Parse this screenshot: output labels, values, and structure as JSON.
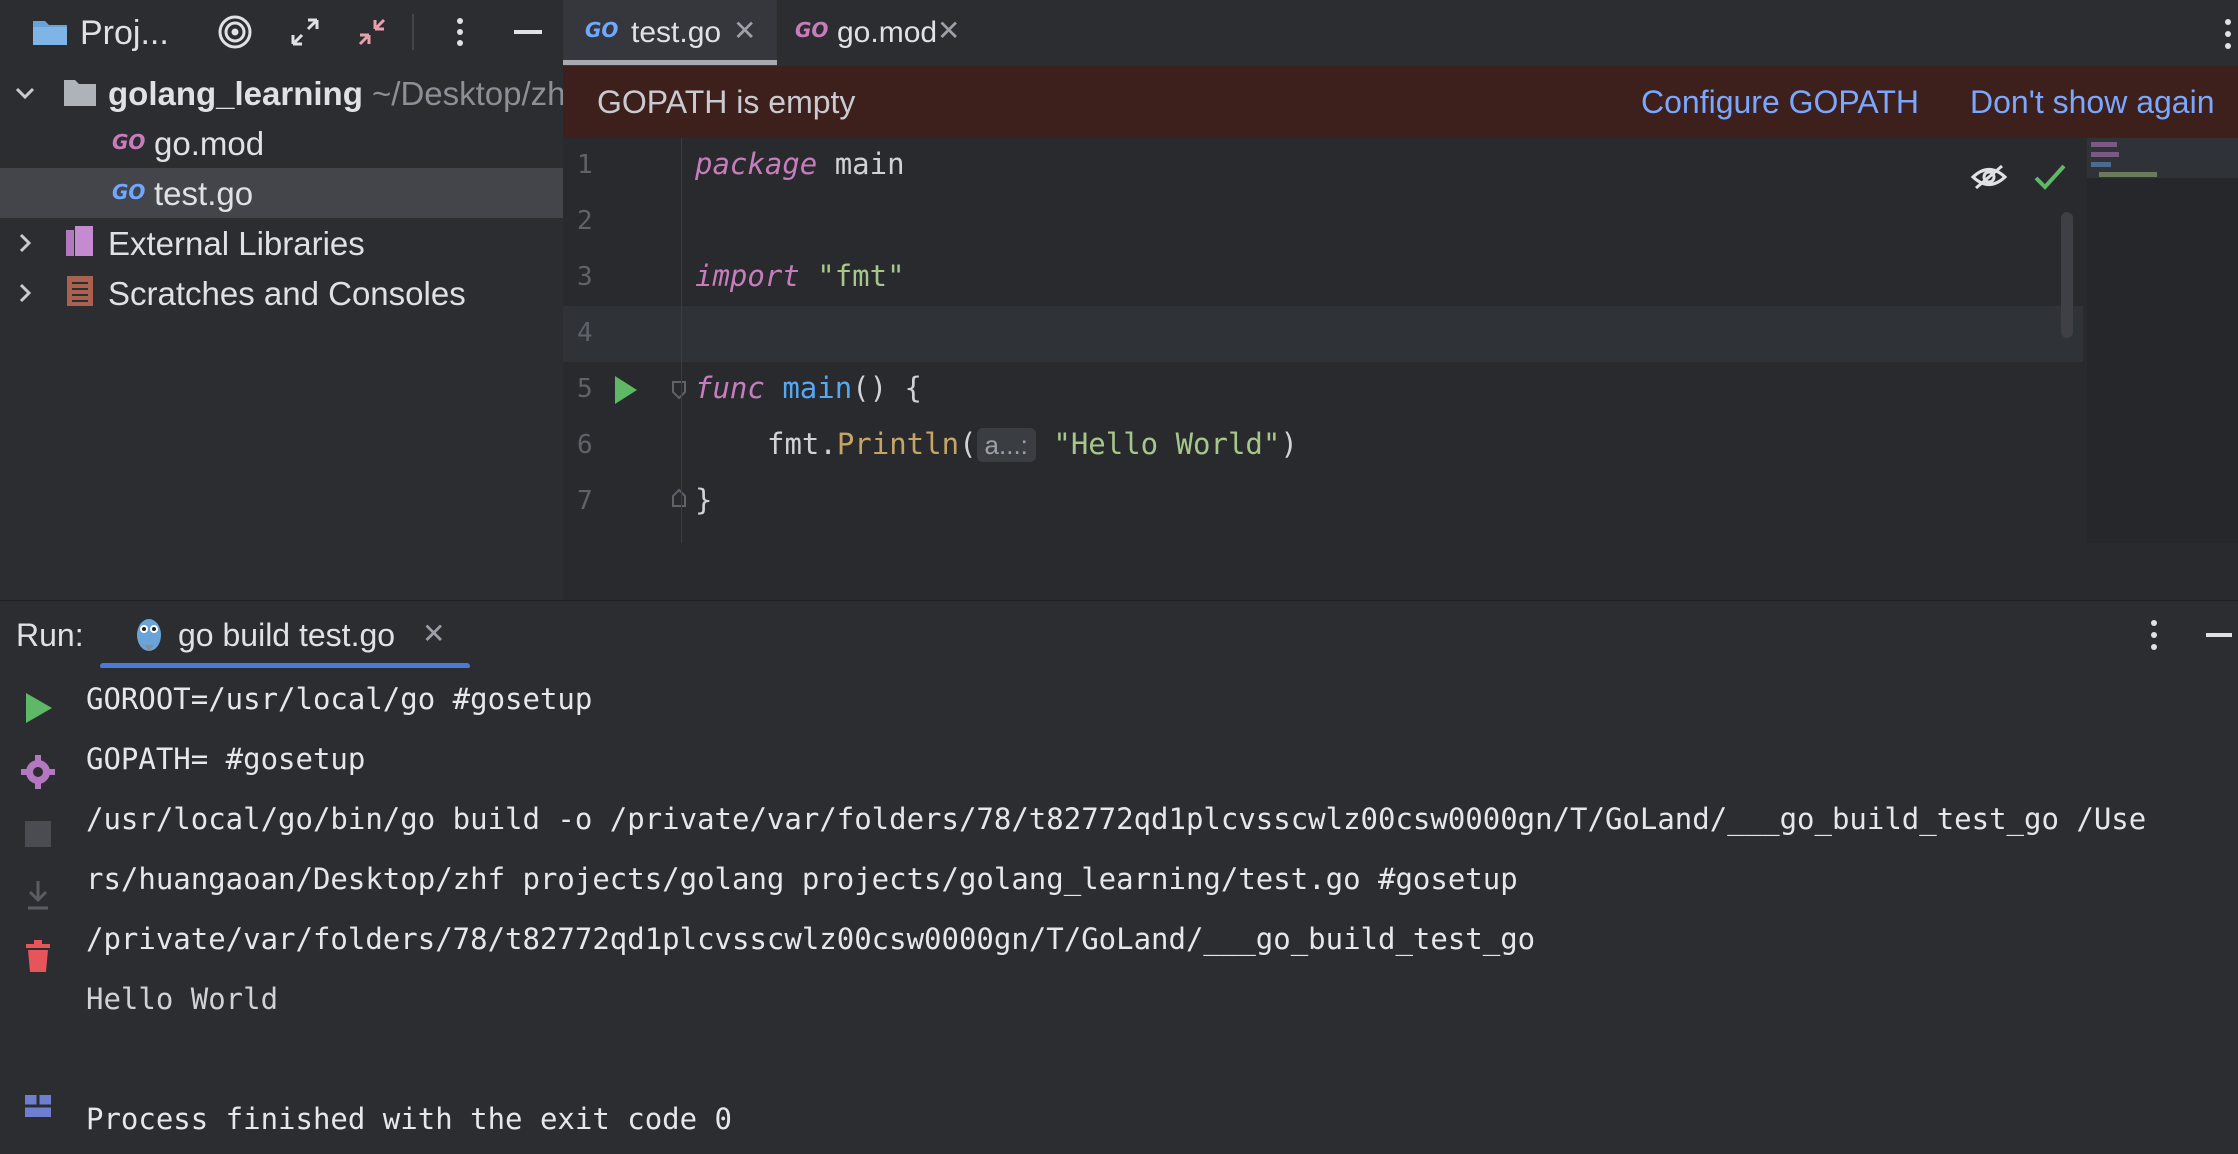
{
  "project": {
    "title": "Proj...",
    "root": {
      "name": "golang_learning",
      "path": "~/Desktop/zh"
    },
    "files": [
      {
        "badge": "GO",
        "name": "go.mod"
      },
      {
        "badge": "GO",
        "name": "test.go"
      }
    ],
    "external_libraries": "External Libraries",
    "scratches": "Scratches and Consoles"
  },
  "tabs": [
    {
      "badge": "GO",
      "label": "test.go",
      "close": "✕"
    },
    {
      "badge": "GO",
      "label": "go.mod",
      "close": "✕"
    }
  ],
  "banner": {
    "message": "GOPATH is empty",
    "configure": "Configure GOPATH",
    "dismiss": "Don't show again"
  },
  "code": {
    "line_numbers": [
      "1",
      "2",
      "3",
      "4",
      "5",
      "6",
      "7"
    ],
    "pkg_kw": "package",
    "pkg_name": "main",
    "import_kw": "import",
    "import_path": "\"fmt\"",
    "func_kw": "func",
    "func_name": "main",
    "func_rest": "() {",
    "call_obj": "fmt.",
    "call_fn": "Println",
    "open_paren": "(",
    "hint": "a...:",
    "arg": "\"Hello World\"",
    "close_paren": ")",
    "close_brace": "}"
  },
  "run": {
    "label": "Run:",
    "tab_label": "go build test.go",
    "tab_close": "✕",
    "output": [
      "GOROOT=/usr/local/go #gosetup",
      "GOPATH= #gosetup",
      "/usr/local/go/bin/go build -o /private/var/folders/78/t82772qd1plcvsscwlz00csw0000gn/T/GoLand/___go_build_test_go /Use",
      "rs/huangaoan/Desktop/zhf projects/golang projects/golang_learning/test.go #gosetup",
      "/private/var/folders/78/t82772qd1plcvsscwlz00csw0000gn/T/GoLand/___go_build_test_go",
      "Hello World",
      "",
      "Process finished with the exit code 0"
    ]
  },
  "colors": {
    "accent": "#4b7bd8",
    "run_green": "#5fb865",
    "trash_red": "#e5555a",
    "link": "#7aa7ff"
  }
}
